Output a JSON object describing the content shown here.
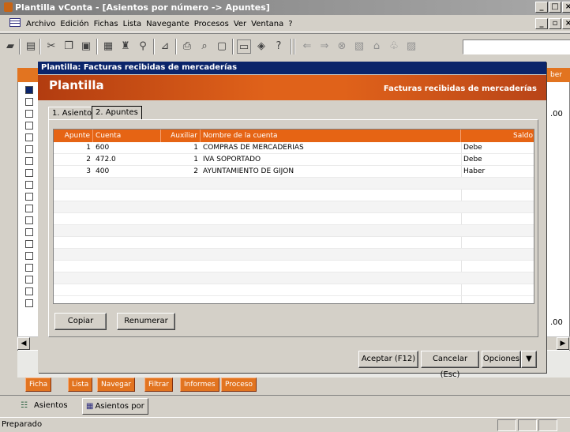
{
  "window": {
    "title": "Plantilla vConta - [Asientos por número -> Apuntes]"
  },
  "menu": [
    "Archivo",
    "Edición",
    "Fichas",
    "Lista",
    "Navegante",
    "Procesos",
    "Ver",
    "Ventana",
    "?"
  ],
  "background": {
    "header_right": "ber",
    "values": [
      ".00",
      ".00"
    ]
  },
  "dialog": {
    "title": "Plantilla: Facturas recibidas de mercaderías",
    "banner_title": "Plantilla",
    "banner_subtitle": "Facturas recibidas de mercaderías",
    "tabs": [
      "1. Asiento",
      "2. Apuntes"
    ],
    "grid": {
      "columns": [
        "Apunte",
        "Cuenta",
        "Auxiliar",
        "Nombre de la cuenta",
        "Saldo"
      ],
      "rows": [
        {
          "apunte": "1",
          "cuenta": "600",
          "auxiliar": "1",
          "nombre": "COMPRAS DE MERCADERIAS",
          "saldo": "Debe"
        },
        {
          "apunte": "2",
          "cuenta": "472.0",
          "auxiliar": "1",
          "nombre": "IVA SOPORTADO",
          "saldo": "Debe"
        },
        {
          "apunte": "3",
          "cuenta": "400",
          "auxiliar": "2",
          "nombre": "AYUNTAMIENTO DE GIJON",
          "saldo": "Haber"
        }
      ]
    },
    "buttons": {
      "copiar": "Copiar",
      "renumerar": "Renumerar",
      "aceptar": "Aceptar (F12)",
      "cancelar": "Cancelar (Esc)",
      "opciones": "Opciones"
    }
  },
  "bottom_tabs": [
    "Ficha",
    "Lista",
    "Navegar",
    "Filtrar",
    "Informes",
    "Proceso"
  ],
  "window_tabs": [
    "Asientos",
    "Asientos por ..."
  ],
  "status": {
    "text": "Preparado"
  }
}
